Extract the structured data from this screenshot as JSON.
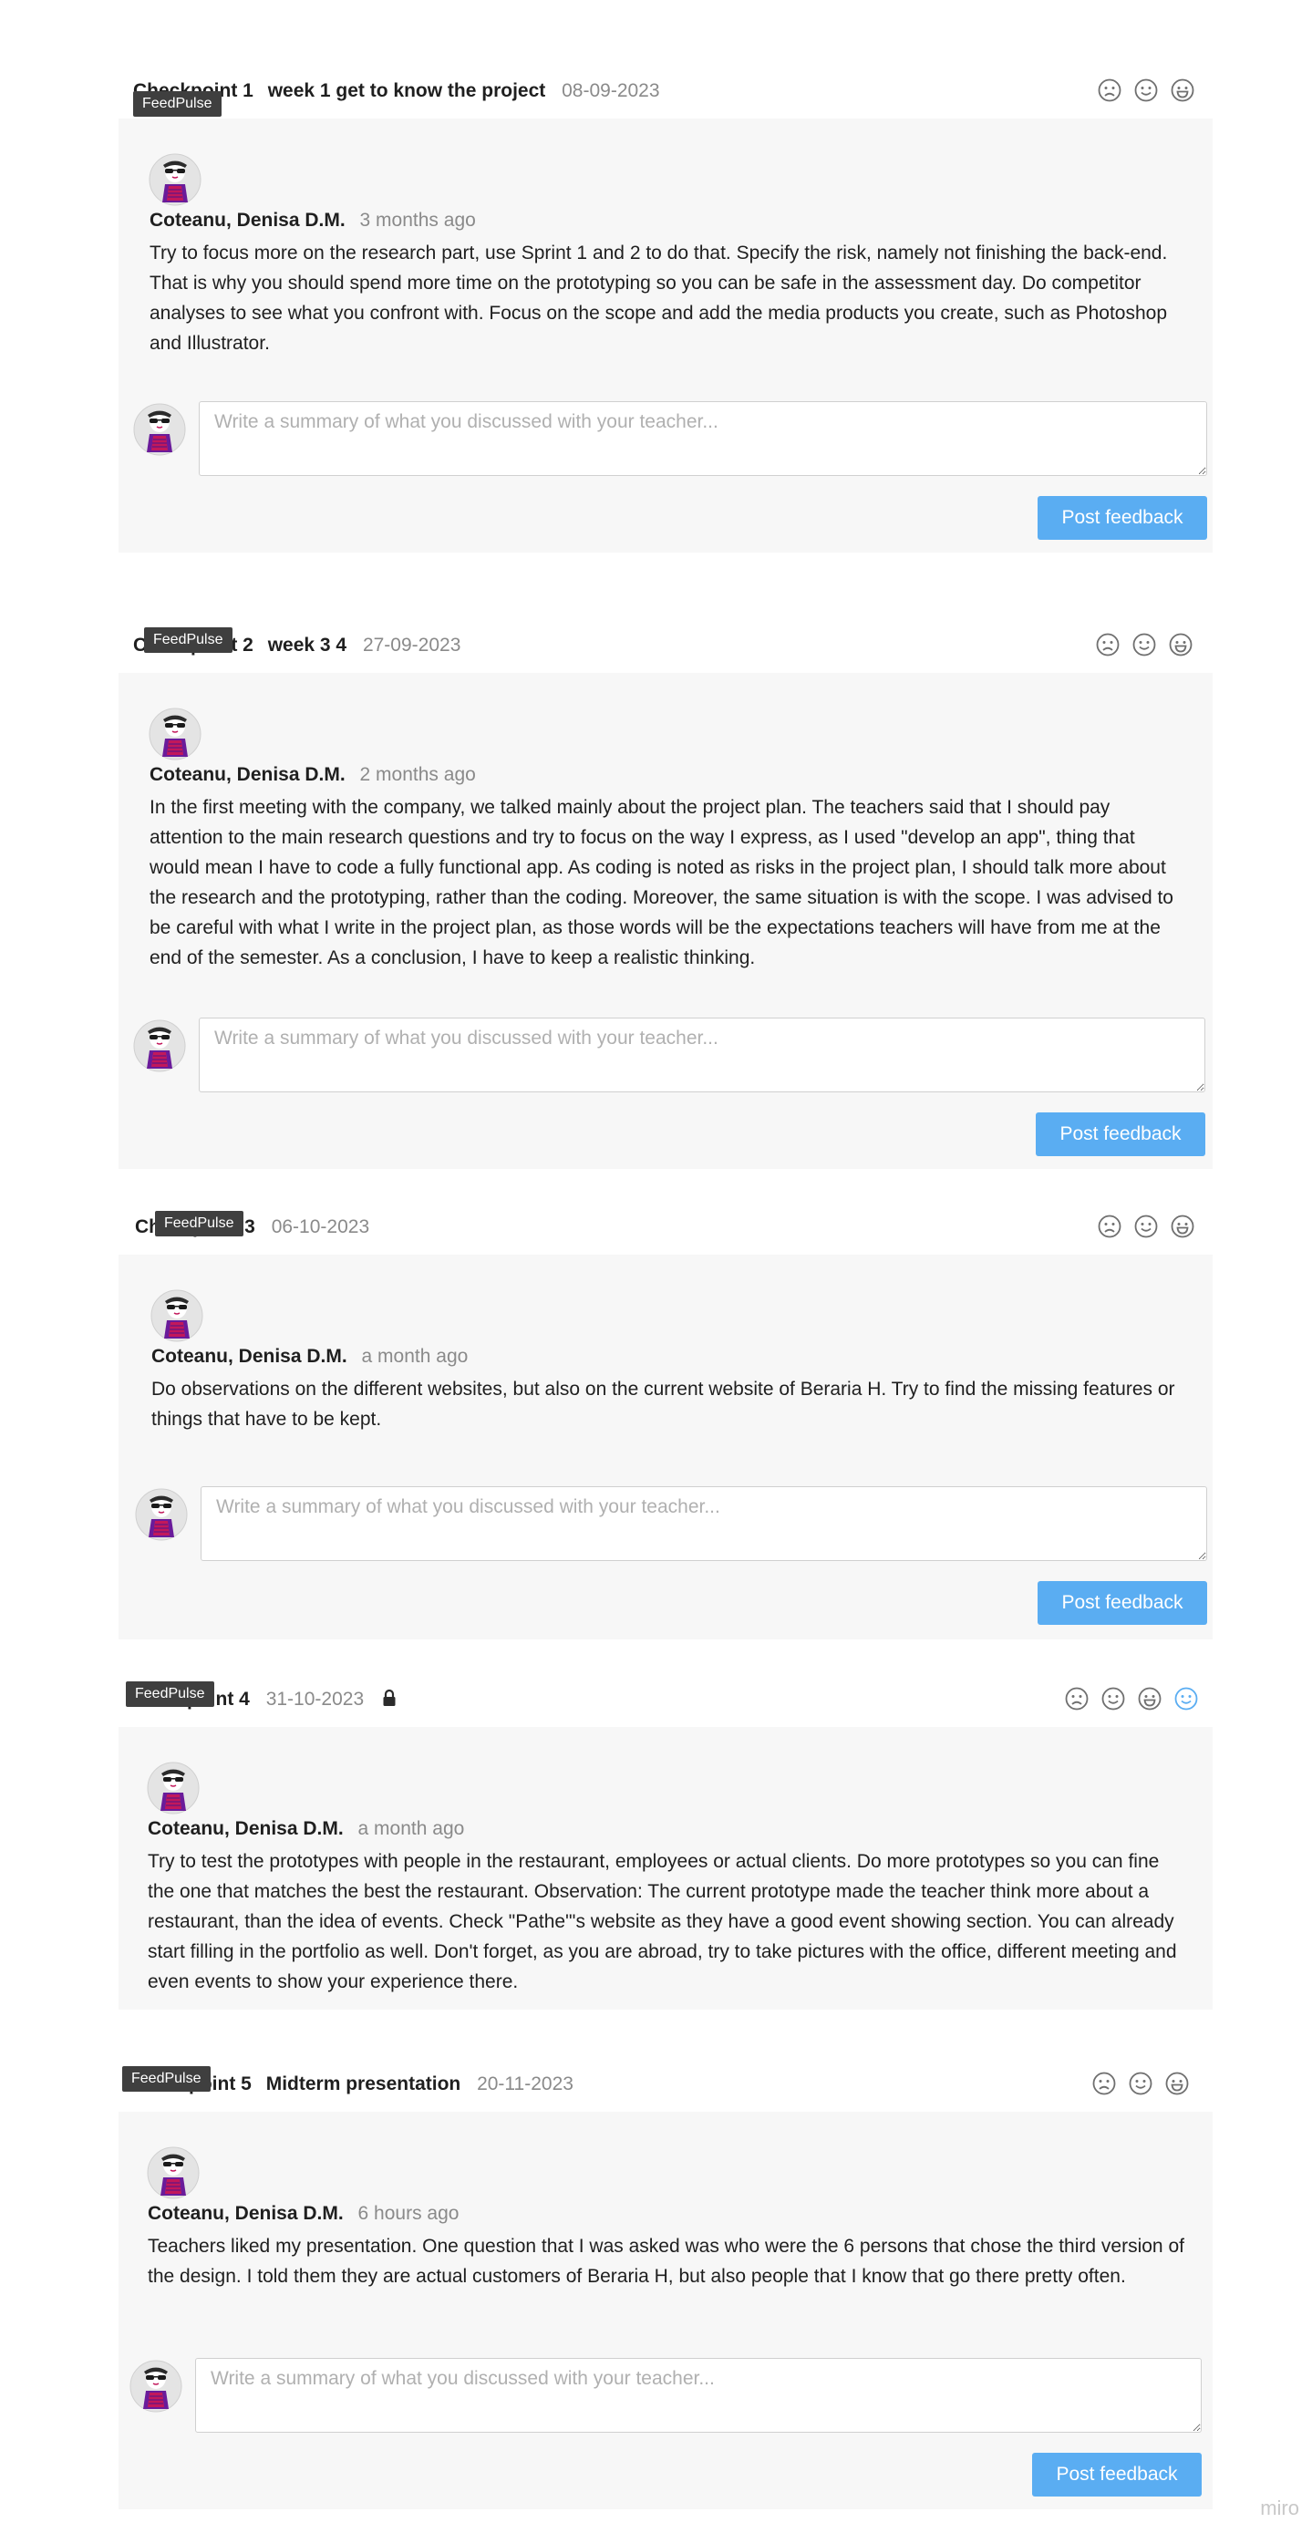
{
  "badge_label": "FeedPulse",
  "placeholder": "Write a summary of what you discussed with your teacher...",
  "post_label": "Post feedback",
  "watermark": "miro",
  "colors": {
    "accent": "#5aadf2",
    "card_bg": "#f7f7f7",
    "badge_bg": "#3f3f3f"
  },
  "checkpoints": [
    {
      "checkpoint": "Checkpoint 1",
      "week": "week 1 get to know the project",
      "date": "08-09-2023",
      "author": "Coteanu, Denisa D.M.",
      "ago": "3 months ago",
      "text": "Try to focus more on the research part, use Sprint 1 and 2 to do that. Specify the risk, namely not finishing the back-end. That is why you should spend more time on the prototyping so you can be safe in the assessment day. Do competitor analyses to see what you confront with. Focus on the scope and add the media products you create, such as Photoshop and Illustrator."
    },
    {
      "checkpoint": "Checkpoint 2",
      "week": "week 3 4",
      "date": "27-09-2023",
      "author": "Coteanu, Denisa D.M.",
      "ago": "2 months ago",
      "text": "In the first meeting with the company, we talked mainly about the project plan. The teachers said that I should pay attention to the main research questions and try to focus on the way I express, as I used \"develop an app\", thing that would mean I have to code a fully functional app. As coding is noted as risks in the project plan, I should talk more about the research and the prototyping, rather than the coding. Moreover, the same situation is with the scope. I was advised to be careful with what I write in the project plan, as those words will be the expectations teachers will have from me at the end of the semester. As a conclusion, I have to keep a realistic thinking."
    },
    {
      "checkpoint": "Checkpoint 3",
      "date": "06-10-2023",
      "author": "Coteanu, Denisa D.M.",
      "ago": "a month ago",
      "text": "Do observations on the different websites, but also on the current website of Beraria H. Try to find the missing features or things that have to be kept."
    },
    {
      "checkpoint": "Checkpoint 4",
      "date": "31-10-2023",
      "author": "Coteanu, Denisa D.M.",
      "ago": "a month ago",
      "text": "Try to test the prototypes with people in the restaurant, employees or actual clients. Do more prototypes so you can fine the one that matches the best the restaurant. Observation: The current prototype made the teacher think more about a restaurant, than the idea of events. Check \"Pathe\"'s website as they have a good event showing section. You can already start filling in the portfolio as well. Don't forget, as you are abroad, try to take pictures with the office, different meeting and even events to show your experience there."
    },
    {
      "checkpoint": "Checkpoint 5",
      "week": "Midterm presentation",
      "date": "20-11-2023",
      "author": "Coteanu, Denisa D.M.",
      "ago": "6 hours ago",
      "text": "Teachers liked my presentation. One question that I was asked was who were the 6 persons that chose the third version of the design. I told them they are actual customers of Beraria H, but also people that I know that go there pretty often."
    }
  ]
}
